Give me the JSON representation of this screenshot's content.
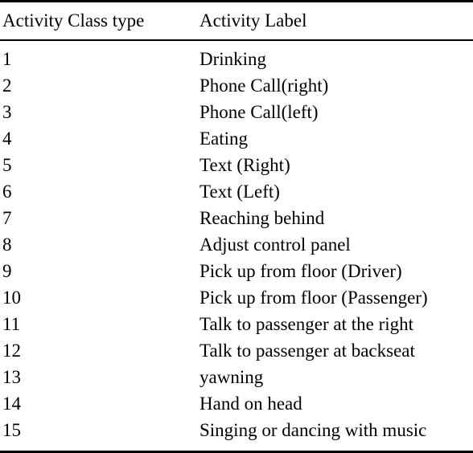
{
  "table": {
    "headers": {
      "class_type": "Activity Class type",
      "label": "Activity Label"
    },
    "rows": [
      {
        "class_type": "1",
        "label": "Drinking"
      },
      {
        "class_type": "2",
        "label": "Phone Call(right)"
      },
      {
        "class_type": "3",
        "label": "Phone Call(left)"
      },
      {
        "class_type": "4",
        "label": "Eating"
      },
      {
        "class_type": "5",
        "label": "Text (Right)"
      },
      {
        "class_type": "6",
        "label": "Text (Left)"
      },
      {
        "class_type": "7",
        "label": "Reaching behind"
      },
      {
        "class_type": "8",
        "label": "Adjust control panel"
      },
      {
        "class_type": "9",
        "label": "Pick up from floor (Driver)"
      },
      {
        "class_type": "10",
        "label": "Pick up from floor (Passenger)"
      },
      {
        "class_type": "11",
        "label": "Talk to passenger at the right"
      },
      {
        "class_type": "12",
        "label": "Talk to passenger at backseat"
      },
      {
        "class_type": "13",
        "label": "yawning"
      },
      {
        "class_type": "14",
        "label": "Hand on head"
      },
      {
        "class_type": "15",
        "label": "Singing or dancing with music"
      }
    ]
  }
}
